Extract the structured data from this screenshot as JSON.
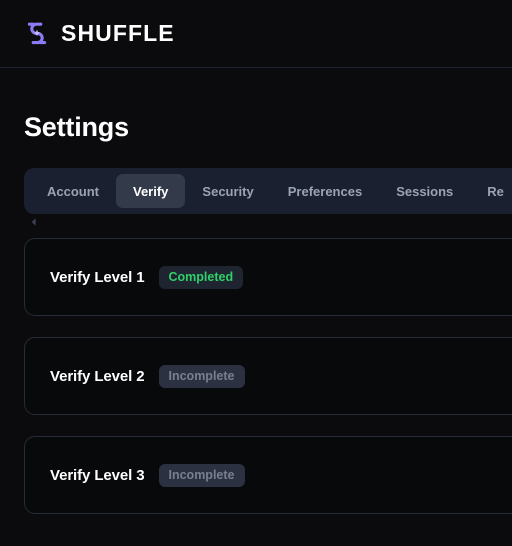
{
  "brand": {
    "name": "SHUFFLE",
    "logo_color": "#8b7cf6",
    "logo_icon": "shuffle-logo-icon"
  },
  "page": {
    "title": "Settings"
  },
  "tabs": {
    "active": "Verify",
    "scroll_left_icon": "chevron-left-icon",
    "items": [
      {
        "label": "Account",
        "active": false
      },
      {
        "label": "Verify",
        "active": true
      },
      {
        "label": "Security",
        "active": false
      },
      {
        "label": "Preferences",
        "active": false
      },
      {
        "label": "Sessions",
        "active": false
      },
      {
        "label": "Re",
        "active": false
      }
    ]
  },
  "colors": {
    "page_background": "#0b0b0d",
    "tabbar_background": "#1b2030",
    "active_tab_background": "#333b4b",
    "card_background": "#08090b",
    "card_border": "#262c38",
    "status_completed": "#2fd06a",
    "status_incomplete": "#78808f"
  },
  "verify_levels": [
    {
      "title": "Verify Level 1",
      "status": "Completed",
      "status_type": "completed"
    },
    {
      "title": "Verify Level 2",
      "status": "Incomplete",
      "status_type": "incomplete"
    },
    {
      "title": "Verify Level 3",
      "status": "Incomplete",
      "status_type": "incomplete"
    }
  ]
}
